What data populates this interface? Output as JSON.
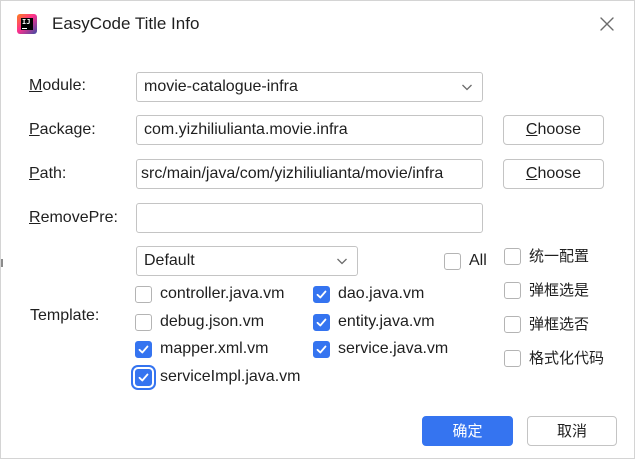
{
  "window": {
    "title": "EasyCode Title Info",
    "icon": "intellij-app-icon",
    "close_icon": "close-icon"
  },
  "form": {
    "module": {
      "label": "Module:",
      "mnemonic": "M",
      "rest": "odule:",
      "value": "movie-catalogue-infra"
    },
    "package": {
      "label": "Package:",
      "mnemonic": "P",
      "rest": "ackage:",
      "value": "com.yizhiliulianta.movie.infra",
      "choose": {
        "mnemonic": "C",
        "rest": "hoose",
        "label": "Choose"
      }
    },
    "path": {
      "label": "Path:",
      "mnemonic": "P",
      "rest": "ath:",
      "value": "src/main/java/com/yizhiliulianta/movie/infra",
      "choose": {
        "mnemonic": "C",
        "rest": "hoose",
        "label": "Choose"
      }
    },
    "remove_pre": {
      "label": "RemovePre:",
      "mnemonic": "R",
      "rest": "emovePre:",
      "value": ""
    },
    "template": {
      "label": "Template:",
      "group_value": "Default",
      "all_label": "All",
      "all_checked": false,
      "items": [
        {
          "label": "controller.java.vm",
          "checked": false
        },
        {
          "label": "dao.java.vm",
          "checked": true
        },
        {
          "label": "debug.json.vm",
          "checked": false
        },
        {
          "label": "entity.java.vm",
          "checked": true
        },
        {
          "label": "mapper.xml.vm",
          "checked": true
        },
        {
          "label": "service.java.vm",
          "checked": true
        },
        {
          "label": "serviceImpl.java.vm",
          "checked": true
        }
      ]
    }
  },
  "options": [
    {
      "label": "统一配置",
      "checked": false
    },
    {
      "label": "弹框选是",
      "checked": false
    },
    {
      "label": "弹框选否",
      "checked": false
    },
    {
      "label": "格式化代码",
      "checked": false
    }
  ],
  "footer": {
    "ok_label": "确定",
    "cancel_label": "取消"
  },
  "colors": {
    "accent": "#3574f0",
    "border": "#c4c4c4"
  }
}
